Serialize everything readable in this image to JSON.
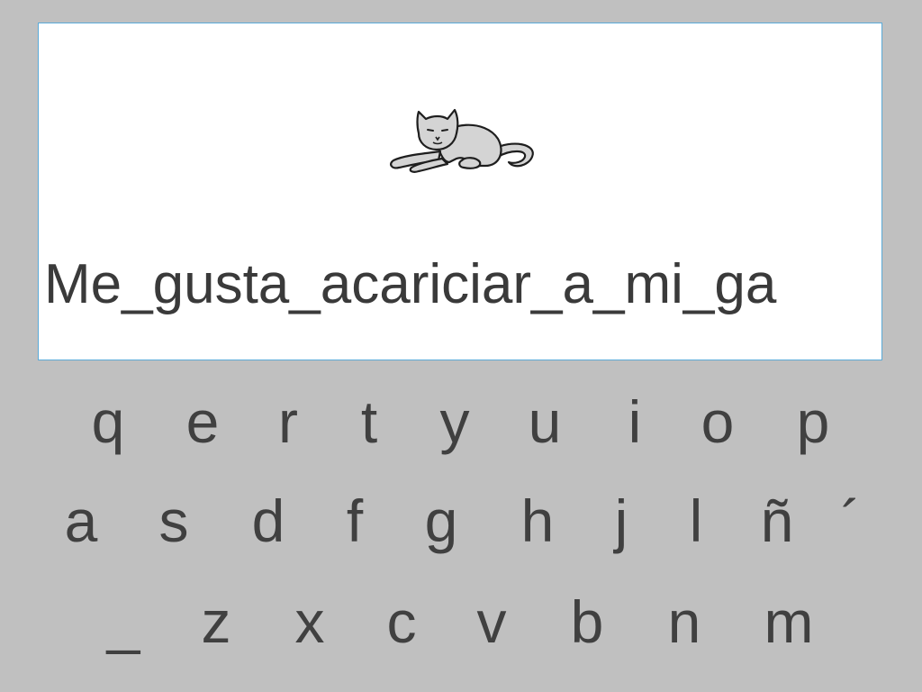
{
  "display": {
    "image_icon": "cat-lying-icon",
    "sentence": "Me_gusta_acariciar_a_mi_ga"
  },
  "keyboard": {
    "row1": [
      "q",
      "e",
      "r",
      "t",
      "y",
      "u",
      "i",
      "o",
      "p"
    ],
    "row2": [
      "a",
      "s",
      "d",
      "f",
      "g",
      "h",
      "j",
      "l",
      "ñ",
      "´"
    ],
    "row3": [
      "_",
      "z",
      "x",
      "c",
      "v",
      "b",
      "n",
      "m"
    ]
  },
  "colors": {
    "background": "#c0c0c0",
    "panel": "#ffffff",
    "panel_border": "#5aaad8",
    "text": "#404040"
  }
}
